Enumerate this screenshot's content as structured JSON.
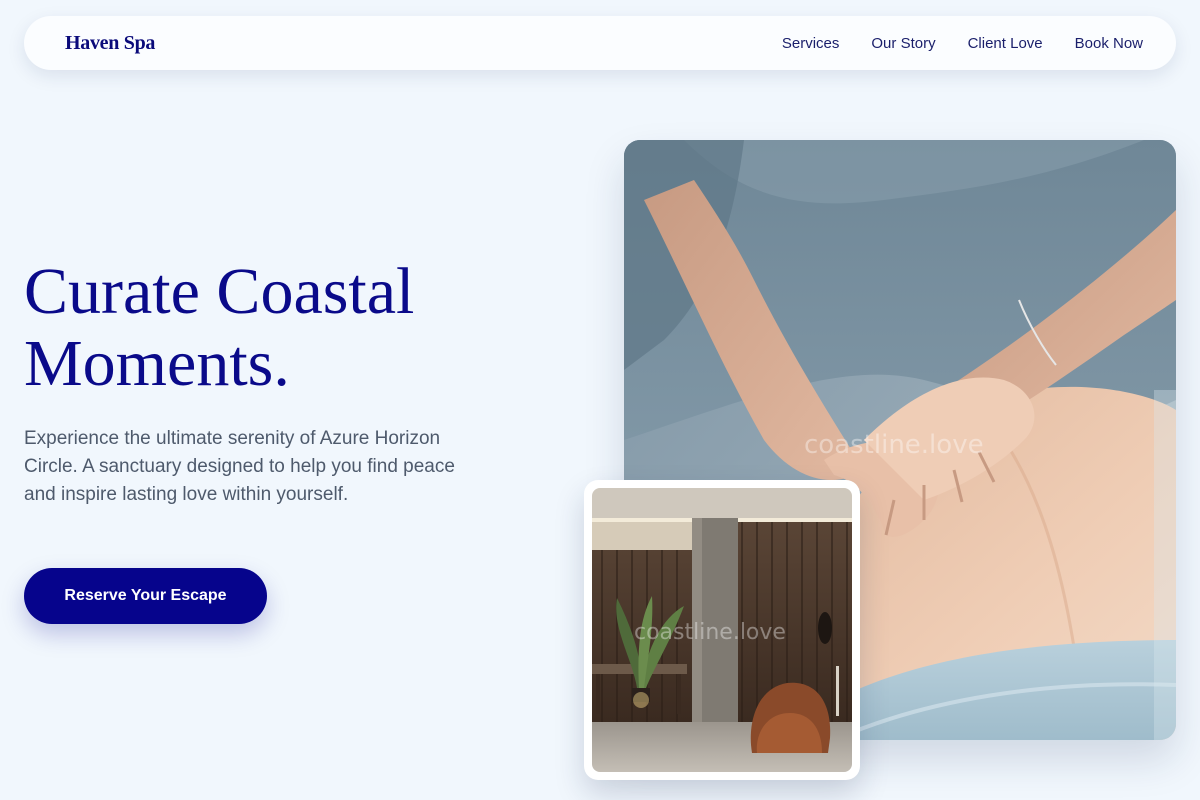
{
  "nav": {
    "brand": "Haven Spa",
    "links": [
      "Services",
      "Our Story",
      "Client Love",
      "Book Now"
    ]
  },
  "hero": {
    "title_line1": "Curate Coastal",
    "title_line2": "Moments.",
    "body": "Experience the ultimate serenity of Azure Horizon Circle. A sanctuary designed to help you find peace and inspire lasting love within yourself.",
    "cta_label": "Reserve Your Escape"
  },
  "images": {
    "main_watermark": "coastline.love",
    "small_watermark": "coastline.love"
  },
  "colors": {
    "background": "#f1f7fd",
    "accent": "#06048c",
    "heading": "#0a0a8a",
    "body_text": "#4e5a6c"
  }
}
